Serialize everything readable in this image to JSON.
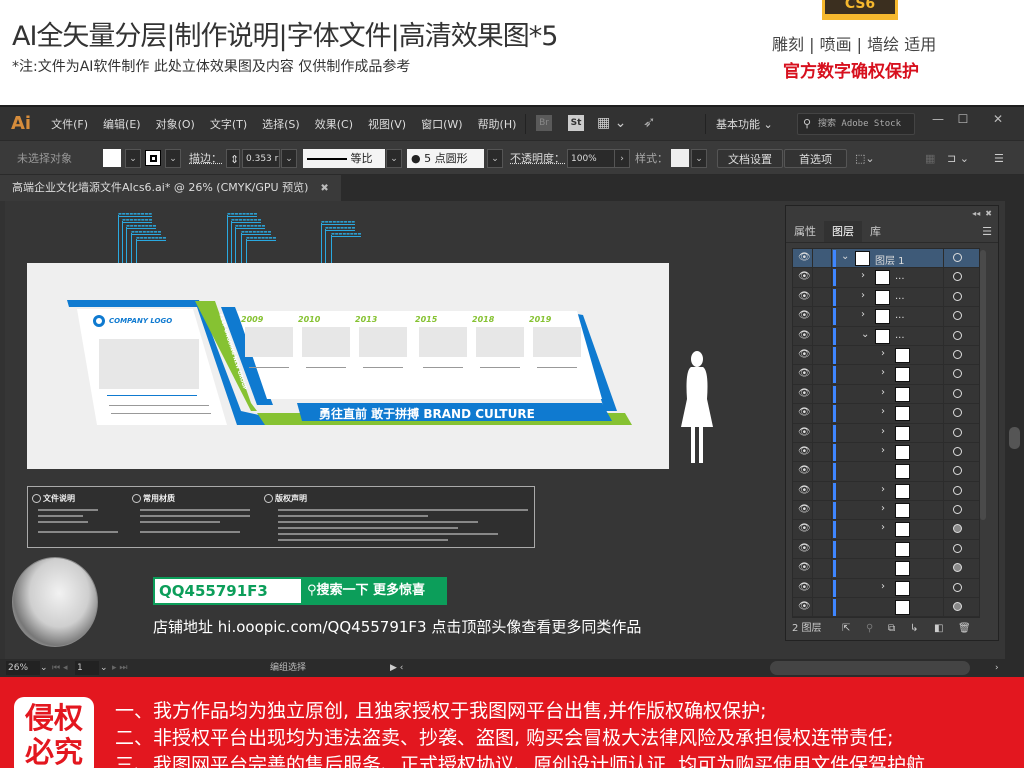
{
  "promo": {
    "title": "AI全矢量分层|制作说明|字体文件|高清效果图*5",
    "note": "*注:文件为AI软件制作 此处立体效果图及内容 仅供制作成品参考",
    "badge": "CS6",
    "usage": "雕刻 | 喷画 | 墙绘 适用",
    "rights": "官方数字确权保护"
  },
  "app": {
    "logo": "Ai",
    "menu": [
      "文件(F)",
      "编辑(E)",
      "对象(O)",
      "文字(T)",
      "选择(S)",
      "效果(C)",
      "视图(V)",
      "窗口(W)",
      "帮助(H)"
    ],
    "bridge_label": "Br",
    "stock_label": "St",
    "workspace": "基本功能",
    "stock_search_placeholder": "搜索 Adobe Stock",
    "window_buttons": [
      "—",
      "☐",
      "✕"
    ]
  },
  "control_bar": {
    "selection_status": "未选择对象",
    "stroke_label": "描边：",
    "stroke_weight": "0.353 r",
    "stroke_profile": "等比",
    "brush": "5 点圆形",
    "opacity_label": "不透明度：",
    "opacity_value": "100%",
    "style_label": "样式：",
    "doc_setup_button": "文档设置",
    "prefs_button": "首选项"
  },
  "document_tab": {
    "title": "高端企业文化墙源文件AIcs6.ai* @ 26% (CMYK/GPU 预览)"
  },
  "artwork": {
    "company_logo": "COMPANY LOGO",
    "vertical_slogan": "KEEP ONGOING NEW GROUP",
    "years": [
      "2009",
      "2010",
      "2013",
      "2015",
      "2018",
      "2019"
    ],
    "slogan": "勇往直前 敢于拼搏 BRAND CULTURE",
    "info_sections": [
      "文件说明",
      "常用材质",
      "版权声明"
    ]
  },
  "promo_overlay": {
    "qq_id": "QQ455791F3",
    "search_button": "搜索一下 更多惊喜",
    "shop_line": "店铺地址 hi.ooopic.com/QQ455791F3   点击顶部头像查看更多同类作品"
  },
  "layers_panel": {
    "tabs": [
      "属性",
      "图层",
      "库"
    ],
    "active_tab": "图层",
    "rows": [
      {
        "name": "图层 1",
        "indent": 0,
        "chevron": "⌄",
        "selected": true,
        "target_filled": false
      },
      {
        "name": "...",
        "indent": 1,
        "chevron": "›",
        "selected": false,
        "target_filled": false
      },
      {
        "name": "...",
        "indent": 1,
        "chevron": "›",
        "selected": false,
        "target_filled": false
      },
      {
        "name": "...",
        "indent": 1,
        "chevron": "›",
        "selected": false,
        "target_filled": false
      },
      {
        "name": "...",
        "indent": 1,
        "chevron": "⌄",
        "selected": false,
        "target_filled": false
      },
      {
        "name": "",
        "indent": 2,
        "chevron": "›",
        "selected": false,
        "target_filled": false
      },
      {
        "name": "",
        "indent": 2,
        "chevron": "›",
        "selected": false,
        "target_filled": false
      },
      {
        "name": "",
        "indent": 2,
        "chevron": "›",
        "selected": false,
        "target_filled": false
      },
      {
        "name": "",
        "indent": 2,
        "chevron": "›",
        "selected": false,
        "target_filled": false
      },
      {
        "name": "",
        "indent": 2,
        "chevron": "›",
        "selected": false,
        "target_filled": false
      },
      {
        "name": "",
        "indent": 2,
        "chevron": "›",
        "selected": false,
        "target_filled": false
      },
      {
        "name": "",
        "indent": 2,
        "chevron": "",
        "selected": false,
        "target_filled": false
      },
      {
        "name": "",
        "indent": 2,
        "chevron": "›",
        "selected": false,
        "target_filled": false
      },
      {
        "name": "",
        "indent": 2,
        "chevron": "›",
        "selected": false,
        "target_filled": false
      },
      {
        "name": "",
        "indent": 2,
        "chevron": "›",
        "selected": false,
        "target_filled": true
      },
      {
        "name": "",
        "indent": 2,
        "chevron": "",
        "selected": false,
        "target_filled": false
      },
      {
        "name": "",
        "indent": 2,
        "chevron": "",
        "selected": false,
        "target_filled": true
      },
      {
        "name": "",
        "indent": 2,
        "chevron": "›",
        "selected": false,
        "target_filled": false
      },
      {
        "name": "",
        "indent": 2,
        "chevron": "",
        "selected": false,
        "target_filled": true
      }
    ],
    "layer_count": "2 图层"
  },
  "status_bar": {
    "zoom": "26%",
    "artboard": "1",
    "tool_status": "编组选择"
  },
  "banner": {
    "badge": "侵权必究",
    "lines": [
      "一、我方作品均为独立原创, 且独家授权于我图网平台出售,并作版权确权保护;",
      "二、非授权平台出现均为违法盗卖、抄袭、盗图, 购买会冒极大法律风险及承担侵权连带责任;",
      "三、我图网平台完善的售后服务、正式授权协议、原创设计师认证, 均可为购买使用文件保驾护航."
    ]
  },
  "colors": {
    "brand_blue": "#0f7ad0",
    "brand_green": "#86c232",
    "promo_green": "#0c9e5a",
    "banner_red": "#e3171f",
    "ui_dark": "#323232",
    "layer_color": "#3f86ff"
  }
}
